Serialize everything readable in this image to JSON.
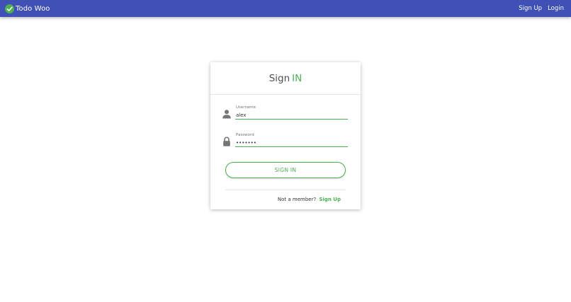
{
  "navbar": {
    "brand_icon": "check-circle-icon",
    "brand_title": "Todo Woo",
    "links": [
      "Sign Up",
      "Login"
    ],
    "bg_color": "#3f51b5"
  },
  "signin_card": {
    "title_main": "Sign",
    "title_accent": "IN",
    "username": {
      "icon": "user-icon",
      "label": "Username",
      "value": "alex"
    },
    "password": {
      "icon": "lock-icon",
      "label": "Password",
      "value": "•••••••"
    },
    "submit_label": "SIGN IN",
    "footer_prompt": "Not a member?",
    "footer_link": "Sign Up",
    "accent_color": "#4caf50"
  }
}
